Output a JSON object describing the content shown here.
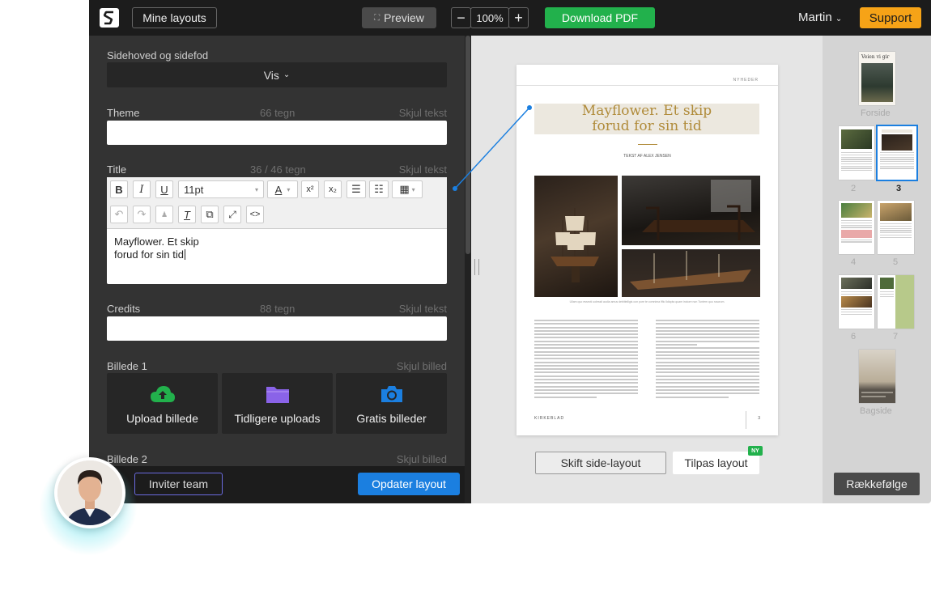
{
  "topbar": {
    "my_layouts": "Mine layouts",
    "preview": "Preview",
    "zoom_out": "−",
    "zoom": "100%",
    "zoom_in": "+",
    "download": "Download PDF",
    "user": "Martin",
    "support": "Support"
  },
  "editor": {
    "header_footer": {
      "label": "Sidehoved og sidefod",
      "value": "Vis"
    },
    "theme": {
      "label": "Theme",
      "count": "66 tegn",
      "hide": "Skjul tekst"
    },
    "title": {
      "label": "Title",
      "count": "36 / 46 tegn",
      "hide": "Skjul tekst",
      "font_size": "11pt",
      "line1": "Mayflower. Et skip",
      "line2": "forud for sin tid"
    },
    "credits": {
      "label": "Credits",
      "count": "88 tegn",
      "hide": "Skjul tekst"
    },
    "image1": {
      "label": "Billede 1",
      "hide": "Skjul billed",
      "upload": "Upload billede",
      "previous": "Tidligere uploads",
      "free": "Gratis billeder"
    },
    "image2": {
      "label": "Billede 2",
      "hide": "Skjul billed"
    },
    "invite": "Inviter team",
    "update": "Opdater layout"
  },
  "page_preview": {
    "section": "NYHEDER",
    "title_line1": "Mayflower. Et skip",
    "title_line2": "forud for sin tid",
    "byline": "TEKST AF ALEX JENSEN",
    "caption": "Ullam quo essecti uolessit audia amus debittelligis con pore te comnima iffic lldiopta quam inctore non Tuntem quo ruscrum.",
    "footer_left": "KIRKEBLAD",
    "page_number": "3"
  },
  "actions": {
    "change_layout": "Skift side-layout",
    "fit_layout": "Tilpas layout",
    "new_badge": "NY"
  },
  "pages_sidebar": {
    "cover_title": "Veien vi gir",
    "front": "Forside",
    "labels": [
      "2",
      "3",
      "4",
      "5",
      "6",
      "7"
    ],
    "back": "Bagside",
    "order": "Rækkefølge"
  },
  "colors": {
    "accent_green": "#22b14c",
    "support_orange": "#f6a317",
    "primary_blue": "#1b7fe0",
    "title_gold": "#b08b3a"
  }
}
